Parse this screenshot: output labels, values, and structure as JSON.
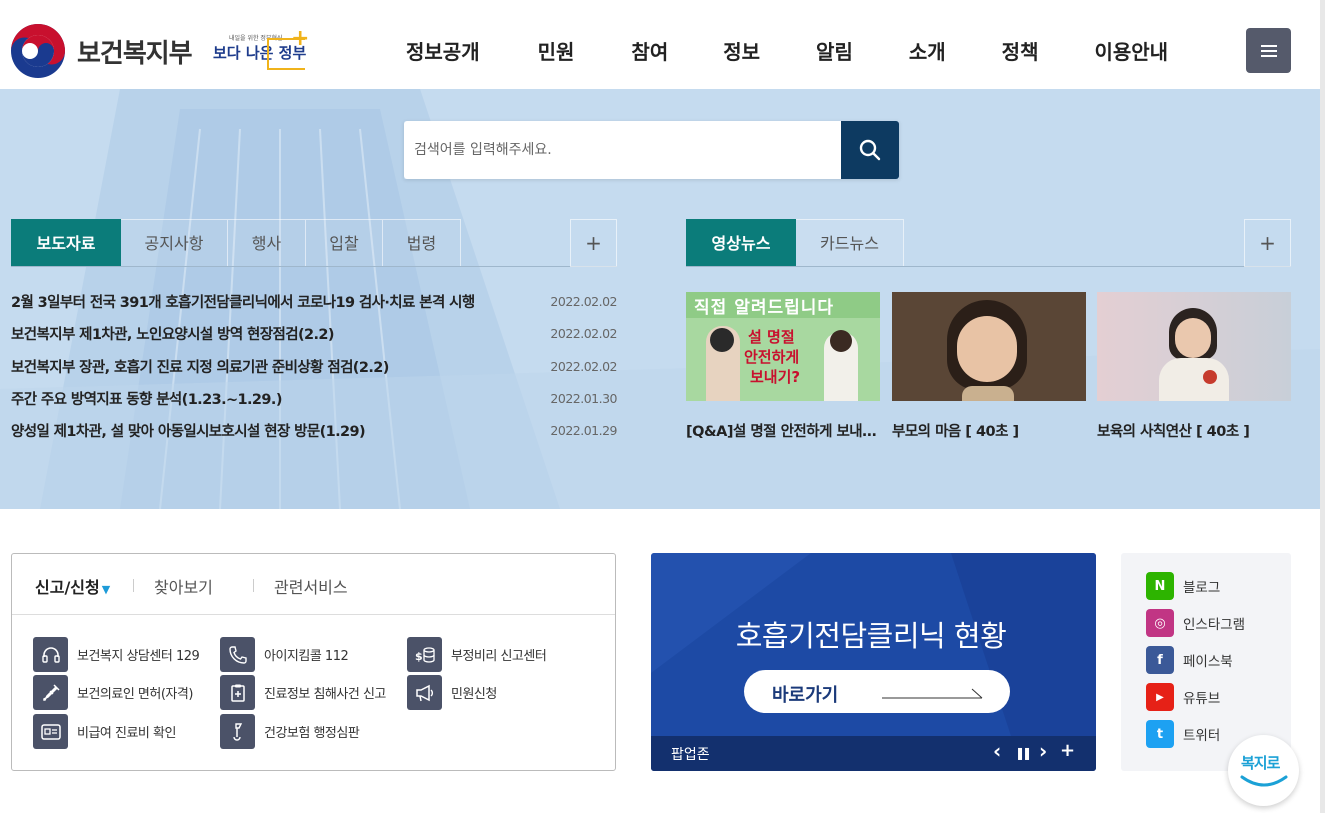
{
  "header": {
    "ministry_name": "보건복지부",
    "slogan_small": "내일을 위한 정부혁신",
    "slogan_main_a": "보다 나은",
    "slogan_main_b": "정부",
    "nav": [
      "정보공개",
      "민원",
      "참여",
      "정보",
      "알림",
      "소개",
      "정책",
      "이용안내"
    ]
  },
  "search": {
    "placeholder": "검색어를 입력해주세요."
  },
  "news_tabs": [
    "보도자료",
    "공지사항",
    "행사",
    "입찰",
    "법령"
  ],
  "news_active": "보도자료",
  "news_items": [
    {
      "title": "2월 3일부터 전국 391개 호흡기전담클리닉에서 코로나19 검사·치료 본격 시행",
      "date": "2022.02.02"
    },
    {
      "title": "보건복지부 제1차관, 노인요양시설 방역 현장점검(2.2)",
      "date": "2022.02.02"
    },
    {
      "title": "보건복지부 장관, 호흡기 진료 지정 의료기관 준비상황 점검(2.2)",
      "date": "2022.02.02"
    },
    {
      "title": "주간 주요 방역지표 동향 분석(1.23.~1.29.)",
      "date": "2022.01.30"
    },
    {
      "title": "양성일 제1차관, 설 맞아 아동일시보호시설 현장 방문(1.29)",
      "date": "2022.01.29"
    }
  ],
  "video_tabs": [
    "영상뉴스",
    "카드뉴스"
  ],
  "videos": [
    {
      "caption": "[Q&A]설 명절 안전하게 보내기?",
      "thumb_line1": "직접 알려드립니다",
      "thumb_line2": "설 명절",
      "thumb_line3": "안전하게",
      "thumb_line4": "보내기?"
    },
    {
      "caption": "부모의 마음 [ 40초 ]"
    },
    {
      "caption": "보육의 사칙연산 [ 40초 ]"
    }
  ],
  "service_tabs": [
    "신고/신청",
    "찾아보기",
    "관련서비스"
  ],
  "services": [
    {
      "label": "보건복지 상담센터 129",
      "icon": "headset-icon"
    },
    {
      "label": "아이지킴콜 112",
      "icon": "phone-icon"
    },
    {
      "label": "부정비리 신고센터",
      "icon": "money-icon"
    },
    {
      "label": "보건의료인 면허(자격)",
      "icon": "syringe-icon"
    },
    {
      "label": "진료정보 침해사건 신고",
      "icon": "clipboard-icon"
    },
    {
      "label": "민원신청",
      "icon": "megaphone-icon"
    },
    {
      "label": "비급여 진료비 확인",
      "icon": "id-card-icon"
    },
    {
      "label": "건강보험 행정심판",
      "icon": "gavel-icon"
    }
  ],
  "popup": {
    "title": "호흡기전담클리닉 현황",
    "button": "바로가기",
    "zone_label": "팝업존",
    "controls": {
      "prev": "‹",
      "pause": "❚❚",
      "next": "›",
      "more": "+"
    }
  },
  "sns": [
    {
      "label": "블로그",
      "glyph": "N",
      "color": "#2db400"
    },
    {
      "label": "인스타그램",
      "glyph": "◎",
      "color": "#c13584"
    },
    {
      "label": "페이스북",
      "glyph": "f",
      "color": "#3b5998"
    },
    {
      "label": "유튜브",
      "glyph": "▶",
      "color": "#e62117"
    },
    {
      "label": "트위터",
      "glyph": "t",
      "color": "#1da1f2"
    }
  ],
  "chatbot": "복지로",
  "colors": {
    "teal": "#0b7c7a",
    "navy": "#0d3a61",
    "popup_blue": "#1d4aa5",
    "hero_bg": "#c5dbef"
  }
}
